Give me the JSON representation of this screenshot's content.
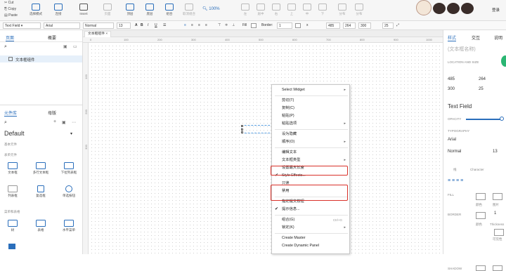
{
  "toolbar": {
    "clipboard": [
      "Cut",
      "Copy",
      "Paste"
    ],
    "select_mode": "选择模式",
    "connect": "连接",
    "insert": "Insert",
    "buttons": [
      "页面",
      "顶层",
      "底层",
      "组合",
      "取消组合"
    ],
    "zoom": "100%",
    "right_buttons": [
      "左",
      "居中",
      "右",
      "上",
      "中",
      "下",
      "分布",
      "分布"
    ],
    "login": "登录"
  },
  "formatbar": {
    "widget_type": "Text Field",
    "font": "Arial",
    "style": "Normal",
    "size": "13",
    "fill_label": "Fill",
    "border_label": "Border:",
    "border_val": "1",
    "x": "485",
    "y": "264",
    "w": "300",
    "h": "25",
    "zoom_val": "100%"
  },
  "leftpanel": {
    "tabs": [
      "页面",
      "概要"
    ],
    "page_item": "文本框组件",
    "lib_tabs": [
      "元件库",
      "母版"
    ],
    "library": "Default",
    "section1": "基本元件",
    "section2": "表单元件",
    "widgets1": [
      "文本框",
      "多行文本框",
      "下拉列表框",
      "列表框",
      "复选框",
      "单选按钮"
    ],
    "section3": "菜单和表格",
    "widgets2": [
      "树",
      "表格",
      "水平菜单"
    ]
  },
  "canvas": {
    "page_tab": "文本框组件",
    "ruler_top": [
      "0",
      "100",
      "200",
      "300",
      "400",
      "500",
      "600",
      "700",
      "800",
      "900",
      "1000"
    ],
    "ruler_left": [
      "100",
      "200",
      "300"
    ]
  },
  "contextmenu": [
    {
      "label": "Select Widget",
      "arrow": true
    },
    {
      "sep": true
    },
    {
      "label": "剪切(T)"
    },
    {
      "label": "复制(C)"
    },
    {
      "label": "粘贴(P)"
    },
    {
      "label": "粘贴选项",
      "arrow": true
    },
    {
      "sep": true
    },
    {
      "label": "设为隐藏"
    },
    {
      "label": "顺序(O)",
      "arrow": true
    },
    {
      "sep": true
    },
    {
      "label": "编辑文本"
    },
    {
      "label": "文本框类型",
      "arrow": true
    },
    {
      "label": "设置最大长度"
    },
    {
      "label": "Style Effects...",
      "check": true
    },
    {
      "label": "只读"
    },
    {
      "label": "禁用"
    },
    {
      "sep": true
    },
    {
      "label": "指定提交按钮"
    },
    {
      "label": "提示信息...",
      "check": true
    },
    {
      "sep": true
    },
    {
      "label": "组合(G)",
      "shortcut": "Ctrl+G"
    },
    {
      "label": "锁定(K)",
      "arrow": true
    },
    {
      "sep": true
    },
    {
      "label": "Create Master"
    },
    {
      "label": "Create Dynamic Panel"
    }
  ],
  "rightpanel": {
    "tabs": [
      "样式",
      "交互",
      "说明"
    ],
    "name_placeholder": "(文本框名称)",
    "location_label": "LOCATION AND SIZE",
    "x": "485",
    "y": "264",
    "w": "300",
    "h": "25",
    "widget_name": "Text Field",
    "opacity_label": "OPACITY",
    "typography_label": "TYPOGRAPHY",
    "font": "Arial",
    "style": "Normal",
    "size": "13",
    "line_label": "线",
    "char_label": "Character",
    "fill_label": "FILL",
    "fill_items": [
      "颜色",
      "图片"
    ],
    "border_label": "BORDER",
    "border_items": [
      "颜色",
      "Thickness",
      "可见性"
    ],
    "border_val": "1",
    "shadow_label": "SHADOW"
  },
  "colors": {
    "accent": "#2a6ebb",
    "highlight": "#d9312a"
  }
}
